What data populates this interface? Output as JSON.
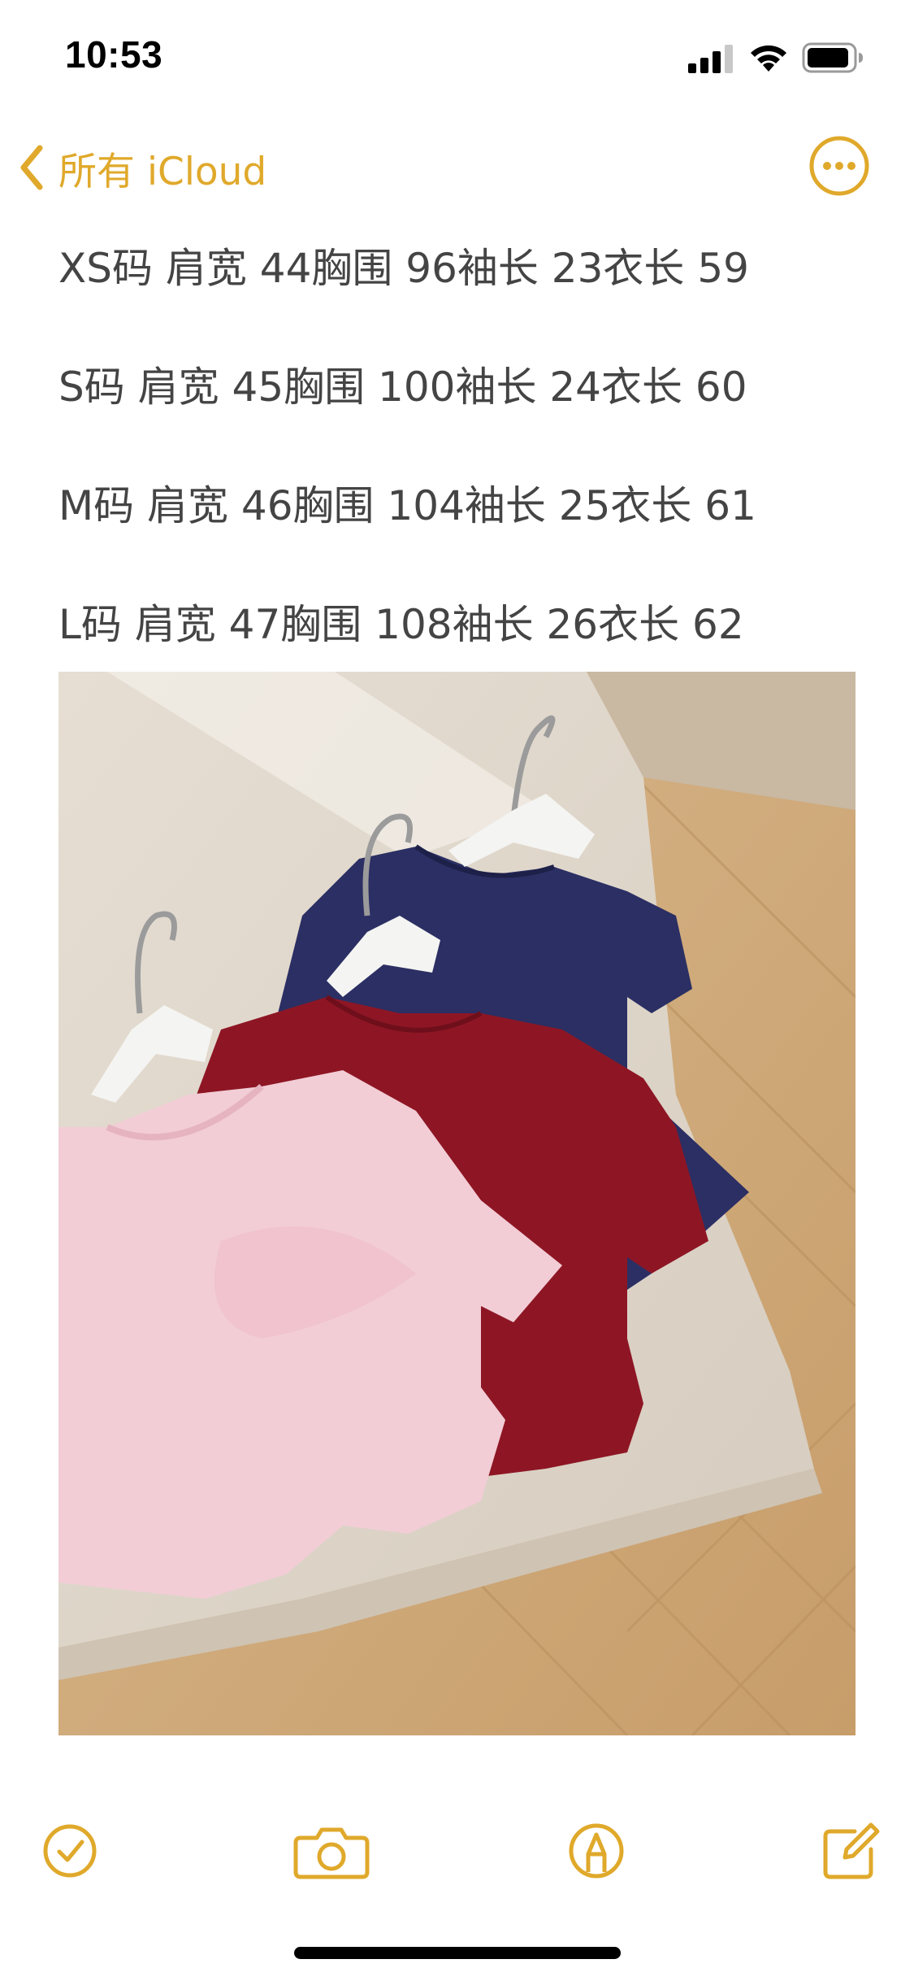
{
  "status_bar": {
    "time": "10:53",
    "icons": [
      "cellular-signal-icon",
      "wifi-icon",
      "battery-icon"
    ]
  },
  "nav": {
    "back_label": "所有 iCloud",
    "back_icon": "chevron-left-icon",
    "more_icon": "ellipsis-circle-icon"
  },
  "note": {
    "lines": [
      "XS码 肩宽 44胸围 96袖长 23衣长 59",
      "S码 肩宽 45胸围 100袖长 24衣长 60",
      "M码 肩宽 46胸围 104袖长 25衣长 61",
      "L码 肩宽 47胸围 108袖长 26衣长 62"
    ],
    "photo": {
      "description_icon": "photo-tshirts-image",
      "shirt_colors": [
        "#2B2F63",
        "#8E1624",
        "#F2CDD6"
      ]
    }
  },
  "toolbar": {
    "items": [
      "checklist-icon",
      "camera-icon",
      "markup-pen-icon",
      "compose-icon"
    ]
  },
  "colors": {
    "accent": "#E0A92B",
    "text": "#444444",
    "background": "#FFFFFF"
  }
}
